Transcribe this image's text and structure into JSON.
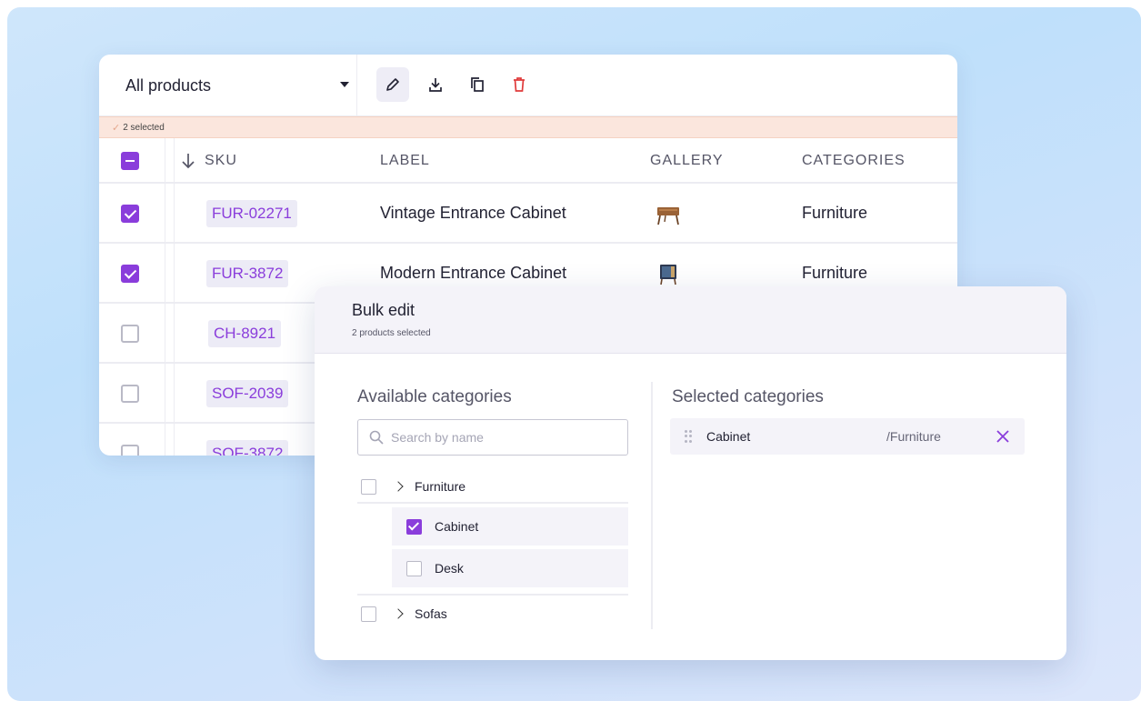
{
  "toolbar": {
    "view_select": "All products",
    "icons": [
      "pencil-icon",
      "download-icon",
      "copy-icon",
      "trash-icon"
    ]
  },
  "selection_banner": "2 selected",
  "table": {
    "columns": [
      "SKU",
      "LABEL",
      "GALLERY",
      "CATEGORIES"
    ],
    "sort_icon": "arrow-down-icon",
    "header_checkbox": "indeterminate",
    "rows": [
      {
        "sku": "FUR-02271",
        "label": "Vintage Entrance Cabinet",
        "category": "Furniture",
        "checked": true
      },
      {
        "sku": "FUR-3872",
        "label": "Modern Entrance Cabinet",
        "category": "Furniture",
        "checked": true
      },
      {
        "sku": "CH-8921",
        "label": "",
        "category": "",
        "checked": false
      },
      {
        "sku": "SOF-2039",
        "label": "",
        "category": "",
        "checked": false
      },
      {
        "sku": "SOF-3872",
        "label": "",
        "category": "",
        "checked": false
      }
    ]
  },
  "bulk_edit": {
    "title": "Bulk edit",
    "subtitle": "2 products selected",
    "available": {
      "title": "Available categories",
      "search_placeholder": "Search by name",
      "tree": [
        {
          "label": "Furniture",
          "checked": false,
          "expanded": true,
          "children": [
            {
              "label": "Cabinet",
              "checked": true
            },
            {
              "label": "Desk",
              "checked": false
            }
          ]
        },
        {
          "label": "Sofas",
          "checked": false,
          "expanded": false
        }
      ]
    },
    "selected": {
      "title": "Selected categories",
      "items": [
        {
          "name": "Cabinet",
          "path": "/Furniture"
        }
      ]
    }
  },
  "colors": {
    "accent": "#8a3ddb",
    "delete": "#e03b3b",
    "banner": "#fbe6dd"
  }
}
